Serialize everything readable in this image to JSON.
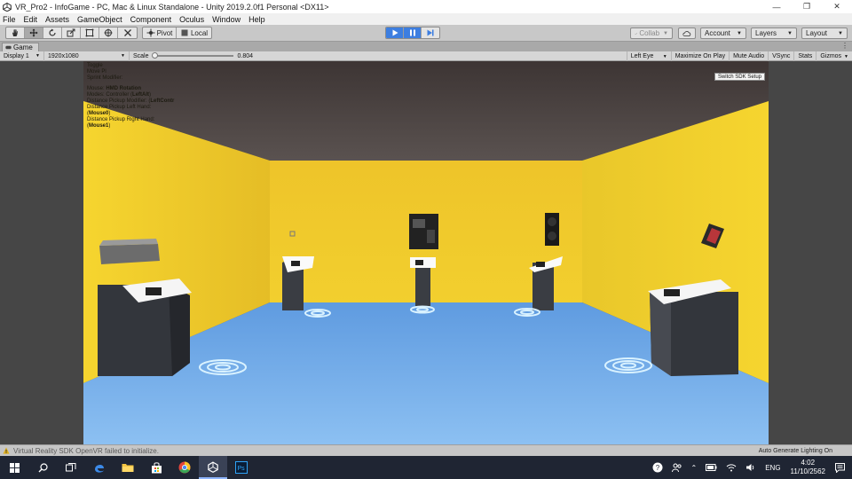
{
  "window": {
    "title": "VR_Pro2 - InfoGame - PC, Mac & Linux Standalone - Unity 2019.2.0f1 Personal <DX11>",
    "minimize": "—",
    "maximize": "❐",
    "close": "✕"
  },
  "menu": [
    "File",
    "Edit",
    "Assets",
    "GameObject",
    "Component",
    "Oculus",
    "Window",
    "Help"
  ],
  "toolbar": {
    "pivot_label": "Pivot",
    "local_label": "Local",
    "collab_label": "Collab",
    "account_label": "Account",
    "layers_label": "Layers",
    "layout_label": "Layout",
    "play_active": true,
    "pause_active": true,
    "accent": "#3d7ee0"
  },
  "tab": {
    "label": "Game"
  },
  "gamebar": {
    "display": "Display 1",
    "resolution": "1920x1080",
    "scale_label": "Scale",
    "scale_value": "0.804",
    "eye": "Left Eye",
    "maximize_on_play": "Maximize On Play",
    "mute_audio": "Mute Audio",
    "vsync": "VSync",
    "stats": "Stats",
    "gizmos": "Gizmos"
  },
  "hud": {
    "line1_label": "Toggle",
    "line2_label": "Move Pl",
    "line3_label": "Sprint Modifier:",
    "mouse_label": "Mouse: ",
    "mouse_value": "HMD Rotation",
    "modes_label": "Modes: Controller (",
    "modes_value": "LeftAlt",
    "modes_end": ")",
    "dpm_label": "Distance Pickup Modifier: (",
    "dpm_value": "LeftContr",
    "dpl_label": "Distance Pickup Left Hand: (",
    "dpl_value": "Mouse0",
    "dpl_end": ")",
    "dpr_label": "Distance Pickup Right Hand: (",
    "dpr_value": "Mouse1",
    "dpr_end": ")"
  },
  "scene": {
    "switch_sdk_button": "Switch SDK Setup",
    "wall_color": "#f2cf2e",
    "floor_color": "#79b1ec",
    "ceiling_color": "#4a4443"
  },
  "status": {
    "message": "Virtual Reality SDK OpenVR failed to initialize.",
    "right": "Auto Generate Lighting On"
  },
  "taskbar": {
    "lang": "ENG",
    "time": "4:02",
    "date": "11/10/2562"
  }
}
